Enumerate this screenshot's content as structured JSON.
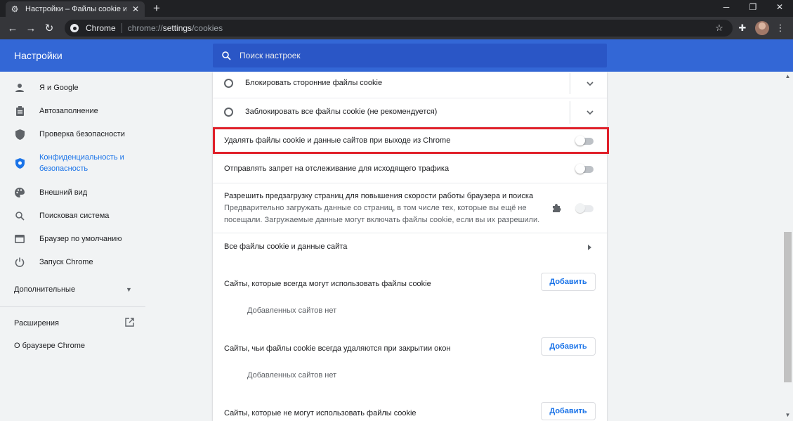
{
  "tab": {
    "title": "Настройки – Файлы cookie и др"
  },
  "omnibox": {
    "site_label": "Chrome",
    "url_scheme": "chrome://",
    "url_host": "settings",
    "url_path": "/cookies"
  },
  "header": {
    "title": "Настройки",
    "search_placeholder": "Поиск настроек"
  },
  "sidebar": {
    "items": [
      {
        "label": "Я и Google",
        "icon": "person-icon"
      },
      {
        "label": "Автозаполнение",
        "icon": "clipboard-icon"
      },
      {
        "label": "Проверка безопасности",
        "icon": "shield-icon"
      },
      {
        "label": "Конфиденциальность и безопасность",
        "icon": "shield-check-icon",
        "active": true
      },
      {
        "label": "Внешний вид",
        "icon": "palette-icon"
      },
      {
        "label": "Поисковая система",
        "icon": "search-icon"
      },
      {
        "label": "Браузер по умолчанию",
        "icon": "browser-icon"
      },
      {
        "label": "Запуск Chrome",
        "icon": "power-icon"
      }
    ],
    "advanced_label": "Дополнительные",
    "extensions_label": "Расширения",
    "about_label": "О браузере Chrome"
  },
  "cookies": {
    "radio_block_third_party": "Блокировать сторонние файлы cookie",
    "radio_block_all": "Заблокировать все файлы cookie (не рекомендуется)",
    "clear_on_exit": {
      "label": "Удалять файлы cookie и данные сайтов при выходе из Chrome",
      "enabled": false
    },
    "do_not_track": {
      "label": "Отправлять запрет на отслеживание для исходящего трафика",
      "enabled": false
    },
    "preload": {
      "title": "Разрешить предзагрузку страниц для повышения скорости работы браузера и поиска",
      "description": "Предварительно загружать данные со страниц, в том числе тех, которые вы ещё не посещали. Загружаемые данные могут включать файлы cookie, если вы их разрешили.",
      "enabled": false
    },
    "all_cookies_link": "Все файлы cookie и данные сайта",
    "sections": [
      {
        "title": "Сайты, которые всегда могут использовать файлы cookie",
        "button": "Добавить",
        "empty": "Добавленных сайтов нет"
      },
      {
        "title": "Сайты, чьи файлы cookie всегда удаляются при закрытии окон",
        "button": "Добавить",
        "empty": "Добавленных сайтов нет"
      },
      {
        "title": "Сайты, которые не могут использовать файлы cookie",
        "button": "Добавить"
      }
    ]
  },
  "colors": {
    "header_blue": "#3367d6",
    "accent": "#1a73e8",
    "highlight_red": "#e0202a"
  }
}
